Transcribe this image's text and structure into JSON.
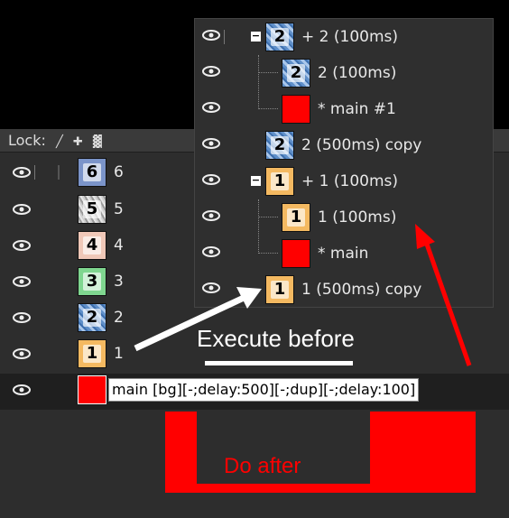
{
  "lock_bar": {
    "label": "Lock:",
    "icons": [
      "brush-icon",
      "move-icon",
      "checker-icon"
    ]
  },
  "back_layers": [
    {
      "num": "6",
      "label": "6",
      "thumb": "tex-6"
    },
    {
      "num": "5",
      "label": "5",
      "thumb": "tex-5"
    },
    {
      "num": "4",
      "label": "4",
      "thumb": "tex-4"
    },
    {
      "num": "3",
      "label": "3",
      "thumb": "tex-3"
    },
    {
      "num": "2",
      "label": "2",
      "thumb": "tex-blue"
    },
    {
      "num": "1",
      "label": "1",
      "thumb": "tex-orange"
    },
    {
      "num": "",
      "label": "main [bg][-;delay:500][-;dup][-;delay:100]",
      "thumb": "tex-red"
    }
  ],
  "front_layers": [
    {
      "num": "2",
      "label": "+ 2  (100ms)",
      "thumb": "tex-blue"
    },
    {
      "num": "2",
      "label": "2  (100ms)",
      "thumb": "tex-blue"
    },
    {
      "num": "",
      "label": "* main #1",
      "thumb": "tex-red"
    },
    {
      "num": "2",
      "label": "2 (500ms) copy",
      "thumb": "tex-blue"
    },
    {
      "num": "1",
      "label": "+ 1  (100ms)",
      "thumb": "tex-orange"
    },
    {
      "num": "1",
      "label": "1  (100ms)",
      "thumb": "tex-orange"
    },
    {
      "num": "",
      "label": "* main",
      "thumb": "tex-red"
    },
    {
      "num": "1",
      "label": "1 (500ms) copy",
      "thumb": "tex-orange"
    }
  ],
  "annotations": {
    "execute_before": "Execute before",
    "do_after": "Do after"
  },
  "colors": {
    "arrow_red": "#ff0000",
    "arrow_white": "#ffffff"
  }
}
